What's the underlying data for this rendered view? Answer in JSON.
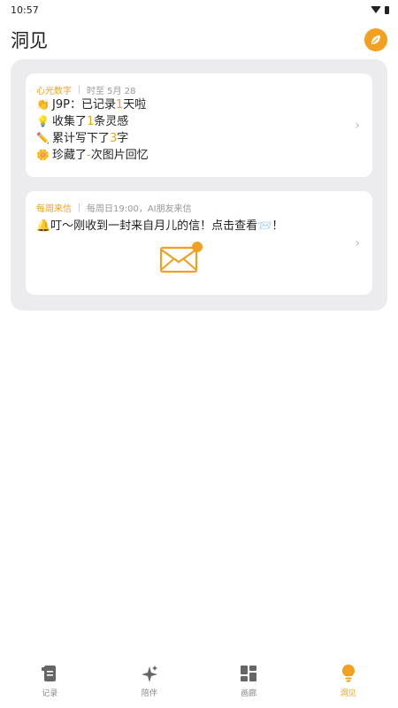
{
  "status": {
    "time": "10:57"
  },
  "header": {
    "title": "洞见"
  },
  "card1": {
    "tag": "心光数字",
    "subtitle": "时至 5月 28",
    "lines": [
      {
        "emoji": "👏",
        "pre": "J9P：已记录",
        "num": "1",
        "post": "天啦"
      },
      {
        "emoji": "💡",
        "pre": "收集了",
        "num": "1",
        "post": "条灵感"
      },
      {
        "emoji": "✏️",
        "pre": "累计写下了",
        "num": "3",
        "post": "字"
      },
      {
        "emoji": "🌼",
        "pre": "珍藏了",
        "num": "-",
        "post": "次图片回忆"
      }
    ]
  },
  "card2": {
    "tag": "每周来信",
    "subtitle": "每周日19:00，AI朋友来信",
    "message": "🔔叮～刚收到一封来自月儿的信！点击查看📨！"
  },
  "tabs": [
    {
      "label": "记录",
      "icon": "journal-icon"
    },
    {
      "label": "陪伴",
      "icon": "sparkle-icon"
    },
    {
      "label": "画廊",
      "icon": "gallery-icon"
    },
    {
      "label": "洞见",
      "icon": "bulb-icon"
    }
  ],
  "colors": {
    "accent": "#f2a020",
    "panel": "#ececef"
  }
}
